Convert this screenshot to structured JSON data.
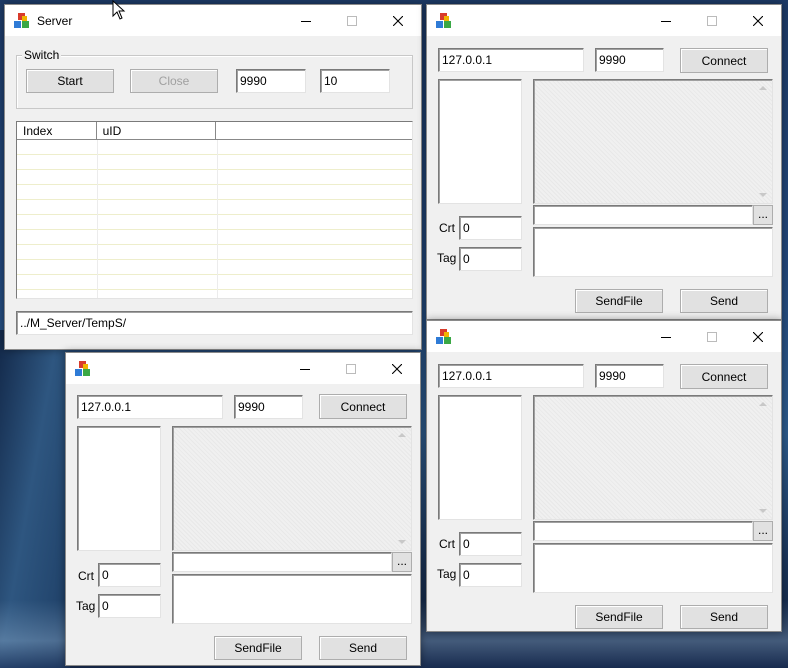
{
  "server": {
    "title": "Server",
    "group_title": "Switch",
    "start_label": "Start",
    "close_label": "Close",
    "port": "9990",
    "max_clients": "10",
    "columns": [
      "Index",
      "uID",
      ""
    ],
    "path": "../M_Server/TempS/"
  },
  "clients": [
    {
      "ip": "127.0.0.1",
      "port": "9990",
      "connect_label": "Connect",
      "crt_label": "Crt",
      "crt_value": "0",
      "tag_label": "Tag",
      "tag_value": "0",
      "browse_label": "...",
      "sendfile_label": "SendFile",
      "send_label": "Send"
    },
    {
      "ip": "127.0.0.1",
      "port": "9990",
      "connect_label": "Connect",
      "crt_label": "Crt",
      "crt_value": "0",
      "tag_label": "Tag",
      "tag_value": "0",
      "browse_label": "...",
      "sendfile_label": "SendFile",
      "send_label": "Send"
    },
    {
      "ip": "127.0.0.1",
      "port": "9990",
      "connect_label": "Connect",
      "crt_label": "Crt",
      "crt_value": "0",
      "tag_label": "Tag",
      "tag_value": "0",
      "browse_label": "...",
      "sendfile_label": "SendFile",
      "send_label": "Send"
    }
  ],
  "icons": {
    "app": "app-blocks-icon",
    "minimize": "minimize-icon",
    "maximize": "maximize-icon",
    "close": "close-icon",
    "cursor": "mouse-cursor-icon"
  },
  "colors": {
    "window_bg": "#f0f0f0",
    "titlebar_bg": "#ffffff",
    "desktop": "#22477a"
  }
}
